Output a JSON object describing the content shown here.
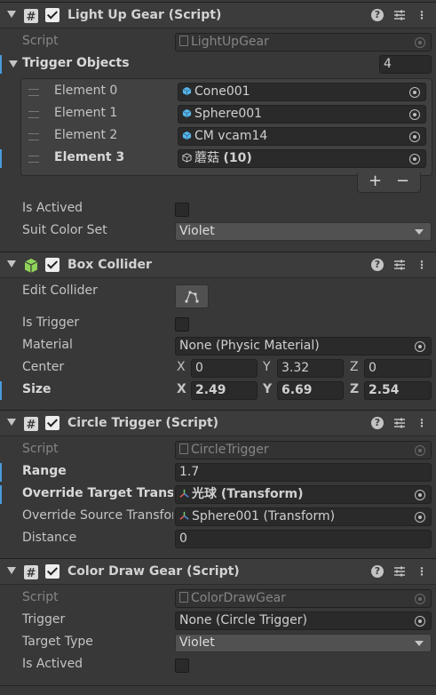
{
  "light_up_gear": {
    "title": "Light Up Gear (Script)",
    "script_label": "Script",
    "script_value": "LightUpGear",
    "trigger_objects_label": "Trigger Objects",
    "trigger_objects_count": "4",
    "elements": [
      {
        "label": "Element 0",
        "value": "Cone001",
        "icon": "cube-icon"
      },
      {
        "label": "Element 1",
        "value": "Sphere001",
        "icon": "cube-icon"
      },
      {
        "label": "Element 2",
        "value": "CM vcam14",
        "icon": "cube-icon"
      },
      {
        "label": "Element 3",
        "value": "蘑菇",
        "value_suffix": "(10)",
        "icon": "prefab-cube-icon"
      }
    ],
    "add_label": "+",
    "remove_label": "−",
    "is_actived_label": "Is Actived",
    "suit_color_set_label": "Suit Color Set",
    "suit_color_set_value": "Violet"
  },
  "box_collider": {
    "title": "Box Collider",
    "edit_collider_label": "Edit Collider",
    "is_trigger_label": "Is Trigger",
    "material_label": "Material",
    "material_value": "None (Physic Material)",
    "center_label": "Center",
    "center": {
      "x": "0",
      "y": "3.32",
      "z": "0"
    },
    "size_label": "Size",
    "size": {
      "x": "2.49",
      "y": "6.69",
      "z": "2.54"
    },
    "axis_x": "X",
    "axis_y": "Y",
    "axis_z": "Z"
  },
  "circle_trigger": {
    "title": "Circle Trigger (Script)",
    "script_label": "Script",
    "script_value": "CircleTrigger",
    "range_label": "Range",
    "range_value": "1.7",
    "override_target_label": "Override Target Transform",
    "override_target_value": "光球",
    "override_target_suffix": "(Transform)",
    "override_source_label": "Override Source Transform",
    "override_source_value": "Sphere001 (Transform)",
    "distance_label": "Distance",
    "distance_value": "0"
  },
  "color_draw_gear": {
    "title": "Color Draw Gear (Script)",
    "script_label": "Script",
    "script_value": "ColorDrawGear",
    "trigger_label": "Trigger",
    "trigger_value": "None (Circle Trigger)",
    "target_type_label": "Target Type",
    "target_type_value": "Violet",
    "is_actived_label": "Is Actived"
  },
  "icons": {
    "help": "?",
    "more": "⋮"
  },
  "colors": {
    "accent": "#4a9adb",
    "cube": "#56b4e9",
    "collider_green": "#8fd35a"
  }
}
